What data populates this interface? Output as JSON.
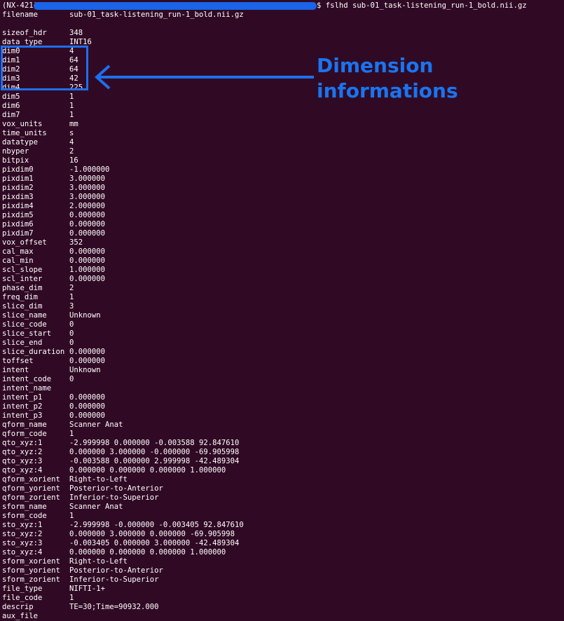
{
  "terminal": {
    "prompt_prefix": "(NX-421)",
    "prompt_suffix": "$",
    "command": "fslhd sub-01_task-listening_run-1_bold.nii.gz"
  },
  "annotation": {
    "line1": "Dimension",
    "line2": "informations",
    "color": "#1a74f0"
  },
  "rows": [
    {
      "key": "filename",
      "value": "sub-01_task-listening_run-1_bold.nii.gz"
    },
    {
      "key": "",
      "value": ""
    },
    {
      "key": "sizeof_hdr",
      "value": "348"
    },
    {
      "key": "data_type",
      "value": "INT16"
    },
    {
      "key": "dim0",
      "value": "4"
    },
    {
      "key": "dim1",
      "value": "64"
    },
    {
      "key": "dim2",
      "value": "64"
    },
    {
      "key": "dim3",
      "value": "42"
    },
    {
      "key": "dim4",
      "value": "225"
    },
    {
      "key": "dim5",
      "value": "1"
    },
    {
      "key": "dim6",
      "value": "1"
    },
    {
      "key": "dim7",
      "value": "1"
    },
    {
      "key": "vox_units",
      "value": "mm"
    },
    {
      "key": "time_units",
      "value": "s"
    },
    {
      "key": "datatype",
      "value": "4"
    },
    {
      "key": "nbyper",
      "value": "2"
    },
    {
      "key": "bitpix",
      "value": "16"
    },
    {
      "key": "pixdim0",
      "value": "-1.000000"
    },
    {
      "key": "pixdim1",
      "value": "3.000000"
    },
    {
      "key": "pixdim2",
      "value": "3.000000"
    },
    {
      "key": "pixdim3",
      "value": "3.000000"
    },
    {
      "key": "pixdim4",
      "value": "2.000000"
    },
    {
      "key": "pixdim5",
      "value": "0.000000"
    },
    {
      "key": "pixdim6",
      "value": "0.000000"
    },
    {
      "key": "pixdim7",
      "value": "0.000000"
    },
    {
      "key": "vox_offset",
      "value": "352"
    },
    {
      "key": "cal_max",
      "value": "0.000000"
    },
    {
      "key": "cal_min",
      "value": "0.000000"
    },
    {
      "key": "scl_slope",
      "value": "1.000000"
    },
    {
      "key": "scl_inter",
      "value": "0.000000"
    },
    {
      "key": "phase_dim",
      "value": "2"
    },
    {
      "key": "freq_dim",
      "value": "1"
    },
    {
      "key": "slice_dim",
      "value": "3"
    },
    {
      "key": "slice_name",
      "value": "Unknown"
    },
    {
      "key": "slice_code",
      "value": "0"
    },
    {
      "key": "slice_start",
      "value": "0"
    },
    {
      "key": "slice_end",
      "value": "0"
    },
    {
      "key": "slice_duration",
      "value": "0.000000"
    },
    {
      "key": "toffset",
      "value": "0.000000"
    },
    {
      "key": "intent",
      "value": "Unknown"
    },
    {
      "key": "intent_code",
      "value": "0"
    },
    {
      "key": "intent_name",
      "value": ""
    },
    {
      "key": "intent_p1",
      "value": "0.000000"
    },
    {
      "key": "intent_p2",
      "value": "0.000000"
    },
    {
      "key": "intent_p3",
      "value": "0.000000"
    },
    {
      "key": "qform_name",
      "value": "Scanner Anat"
    },
    {
      "key": "qform_code",
      "value": "1"
    },
    {
      "key": "qto_xyz:1",
      "value": "-2.999998 0.000000 -0.003588 92.847610"
    },
    {
      "key": "qto_xyz:2",
      "value": "0.000000 3.000000 -0.000000 -69.905998"
    },
    {
      "key": "qto_xyz:3",
      "value": "-0.003588 0.000000 2.999998 -42.489304"
    },
    {
      "key": "qto_xyz:4",
      "value": "0.000000 0.000000 0.000000 1.000000"
    },
    {
      "key": "qform_xorient",
      "value": "Right-to-Left"
    },
    {
      "key": "qform_yorient",
      "value": "Posterior-to-Anterior"
    },
    {
      "key": "qform_zorient",
      "value": "Inferior-to-Superior"
    },
    {
      "key": "sform_name",
      "value": "Scanner Anat"
    },
    {
      "key": "sform_code",
      "value": "1"
    },
    {
      "key": "sto_xyz:1",
      "value": "-2.999998 -0.000000 -0.003405 92.847610"
    },
    {
      "key": "sto_xyz:2",
      "value": "0.000000 3.000000 0.000000 -69.905998"
    },
    {
      "key": "sto_xyz:3",
      "value": "-0.003405 0.000000 3.000000 -42.489304"
    },
    {
      "key": "sto_xyz:4",
      "value": "0.000000 0.000000 0.000000 1.000000"
    },
    {
      "key": "sform_xorient",
      "value": "Right-to-Left"
    },
    {
      "key": "sform_yorient",
      "value": "Posterior-to-Anterior"
    },
    {
      "key": "sform_zorient",
      "value": "Inferior-to-Superior"
    },
    {
      "key": "file_type",
      "value": "NIFTI-1+"
    },
    {
      "key": "file_code",
      "value": "1"
    },
    {
      "key": "descrip",
      "value": "TE=30;Time=90932.000"
    },
    {
      "key": "aux_file",
      "value": ""
    }
  ]
}
